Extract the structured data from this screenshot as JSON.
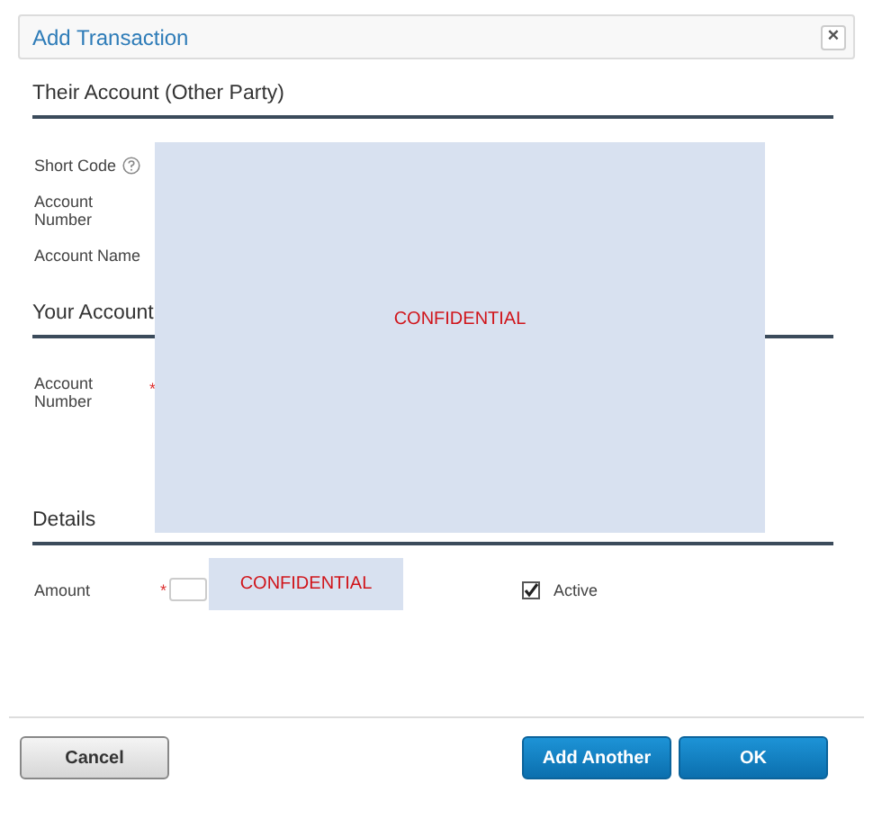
{
  "window": {
    "title": "Add Transaction",
    "close": "×"
  },
  "sections": [
    {
      "heading": "Their Account (Other Party)",
      "fields": [
        {
          "label": "Short Code",
          "kind": "help"
        },
        {
          "label": "Account Number",
          "kind": "plain"
        },
        {
          "label": "Account Name",
          "kind": "plain"
        }
      ]
    },
    {
      "heading": "Your Account",
      "fields": [
        {
          "label": "Account Number",
          "kind": "required",
          "mark": "*"
        }
      ]
    },
    {
      "heading": "Details",
      "fields": [
        {
          "label": "Amount",
          "kind": "amount",
          "mark": "*"
        }
      ]
    }
  ],
  "active": {
    "label": "Active",
    "checked": true
  },
  "redactions": [
    {
      "text": "CONFIDENTIAL"
    },
    {
      "text": "CONFIDENTIAL"
    }
  ],
  "buttons": [
    {
      "label": "Cancel",
      "kind": "secondary"
    },
    {
      "label": "Add Another",
      "kind": "primary"
    },
    {
      "label": "OK",
      "kind": "primary"
    }
  ]
}
